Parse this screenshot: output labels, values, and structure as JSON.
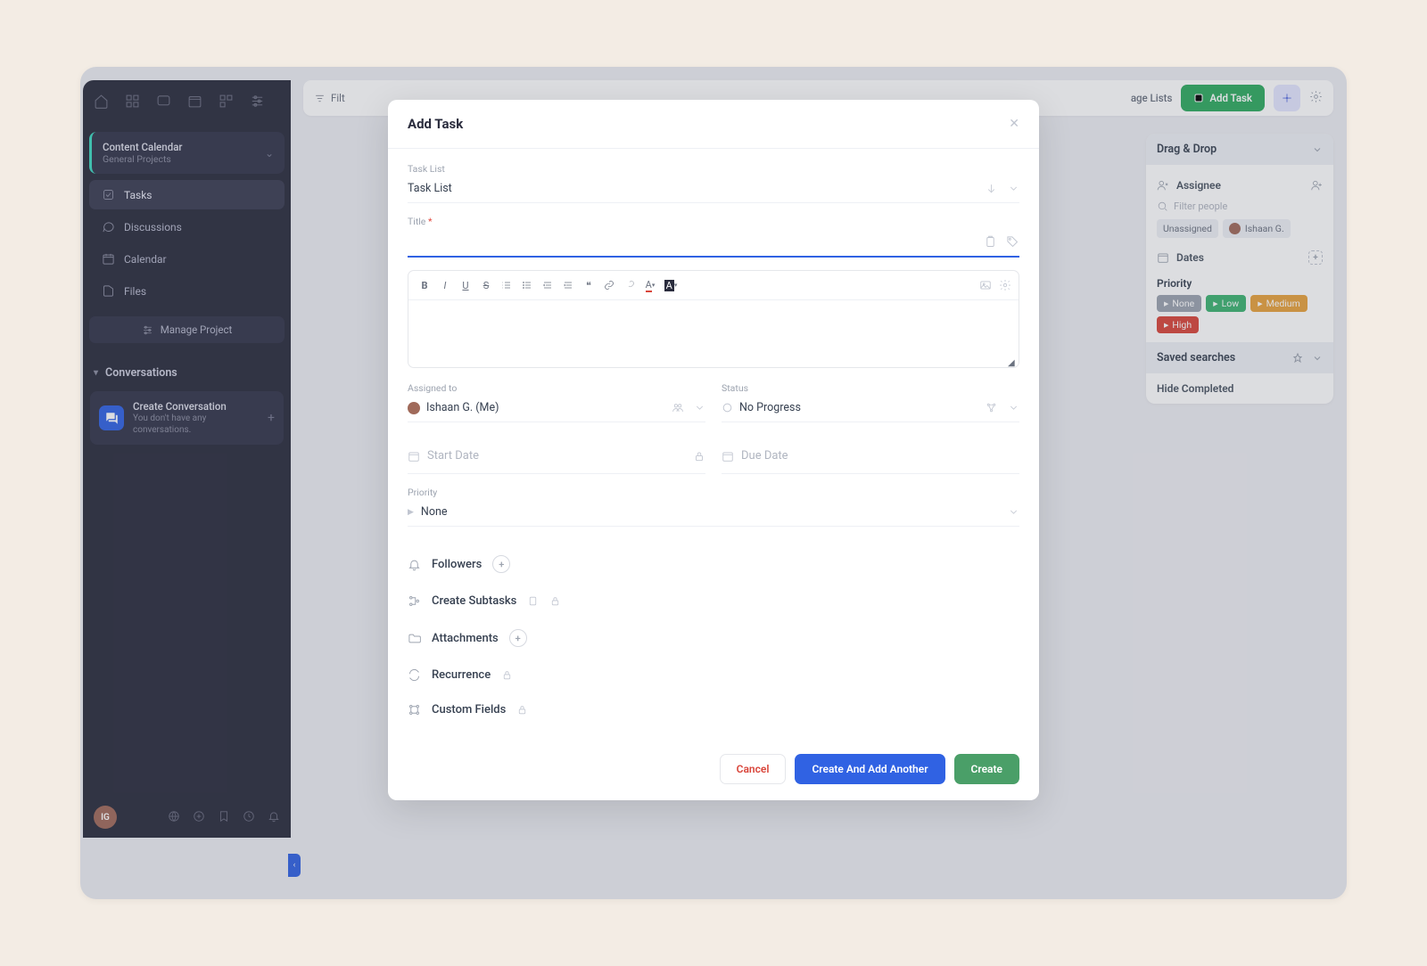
{
  "sidebar": {
    "project": {
      "title": "Content Calendar",
      "subtitle": "General Projects"
    },
    "nav": [
      {
        "label": "Tasks",
        "active": true
      },
      {
        "label": "Discussions"
      },
      {
        "label": "Calendar"
      },
      {
        "label": "Files"
      }
    ],
    "manage": "Manage Project",
    "conversations": {
      "header": "Conversations",
      "create_title": "Create Conversation",
      "create_sub": "You don't have any conversations."
    },
    "avatar": "IG"
  },
  "topbar": {
    "filter": "Filt",
    "age_lists": "age Lists",
    "add_task": "Add Task"
  },
  "rightpanel": {
    "drag_drop": "Drag & Drop",
    "assignee": "Assignee",
    "filter_people": "Filter people",
    "unassigned": "Unassigned",
    "person": "Ishaan G.",
    "dates": "Dates",
    "priority": "Priority",
    "priorities": {
      "none": "None",
      "low": "Low",
      "medium": "Medium",
      "high": "High"
    },
    "saved_searches": "Saved searches",
    "hide_completed": "Hide Completed"
  },
  "modal": {
    "title": "Add Task",
    "labels": {
      "task_list": "Task List",
      "title": "Title",
      "assigned_to": "Assigned to",
      "status": "Status",
      "start_date": "Start Date",
      "due_date": "Due Date",
      "priority": "Priority"
    },
    "values": {
      "task_list": "Task List",
      "assignee": "Ishaan G. (Me)",
      "status": "No Progress",
      "priority": "None"
    },
    "extras": {
      "followers": "Followers",
      "subtasks": "Create Subtasks",
      "attachments": "Attachments",
      "recurrence": "Recurrence",
      "custom_fields": "Custom Fields"
    },
    "buttons": {
      "cancel": "Cancel",
      "create_another": "Create And Add Another",
      "create": "Create"
    }
  }
}
